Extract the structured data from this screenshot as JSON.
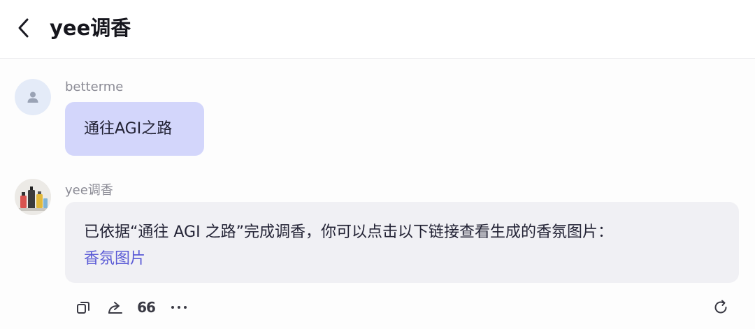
{
  "header": {
    "title": "yee调香"
  },
  "icons": {
    "back": "chevron-left-icon",
    "user_avatar": "user-icon",
    "bot_avatar": "perfume-bottles-avatar",
    "copy": "copy-icon",
    "share": "share-icon",
    "quote": "quote-icon",
    "more": "more-icon",
    "regenerate": "refresh-icon"
  },
  "messages": [
    {
      "sender": "betterme",
      "text": "通往AGI之路"
    },
    {
      "sender": "yee调香",
      "text": "已依据“通往 AGI 之路”完成调香，你可以点击以下链接查看生成的香氛图片：",
      "link_text": "香氛图片"
    }
  ],
  "actions": {
    "quote_glyph": "66",
    "more_glyph": "···"
  },
  "colors": {
    "user_bubble": "#d3d6fb",
    "bot_bubble": "#f0f0f4",
    "link": "#5b5bd6"
  }
}
